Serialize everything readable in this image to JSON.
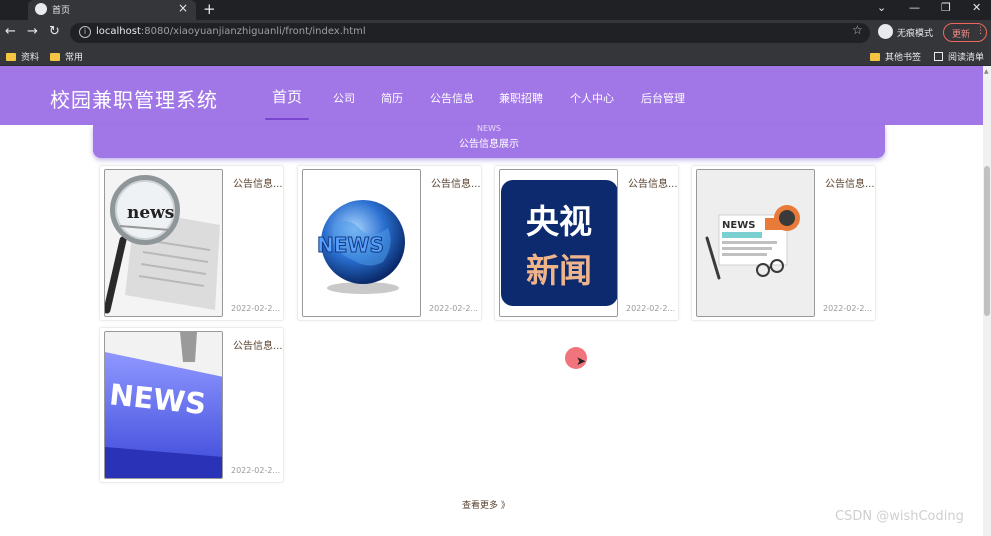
{
  "browser": {
    "tab_title": "首页",
    "url_host": "localhost",
    "url_path": ":8080/xiaoyuanjianzhiguanli/front/index.html",
    "incognito_label": "无痕模式",
    "update_label": "更新",
    "bookmarks": [
      "资料",
      "常用"
    ],
    "bookmarks_right": [
      "其他书签",
      "阅读清单"
    ]
  },
  "site": {
    "title": "校园兼职管理系统",
    "nav": [
      "首页",
      "公司",
      "简历",
      "公告信息",
      "兼职招聘",
      "个人中心",
      "后台管理"
    ],
    "active_nav": "首页"
  },
  "news_section": {
    "title_en": "NEWS",
    "title_cn": "公告信息展示",
    "items": [
      {
        "title": "公告信息...",
        "date": "2022-02-2...",
        "image": "magnifier-newspaper-image"
      },
      {
        "title": "公告信息...",
        "date": "2022-02-2...",
        "image": "globe-news-image"
      },
      {
        "title": "公告信息...",
        "date": "2022-02-2...",
        "image": "cctv-news-image",
        "image_text": [
          "央视",
          "新闻"
        ]
      },
      {
        "title": "公告信息...",
        "date": "2022-02-2...",
        "image": "news-desk-image",
        "image_text": [
          "NEWS"
        ]
      },
      {
        "title": "公告信息...",
        "date": "2022-02-2...",
        "image": "news-keyboard-image",
        "image_text": [
          "NEWS"
        ]
      }
    ],
    "more_label": "查看更多 》"
  },
  "watermark": "CSDN @wishCoding"
}
